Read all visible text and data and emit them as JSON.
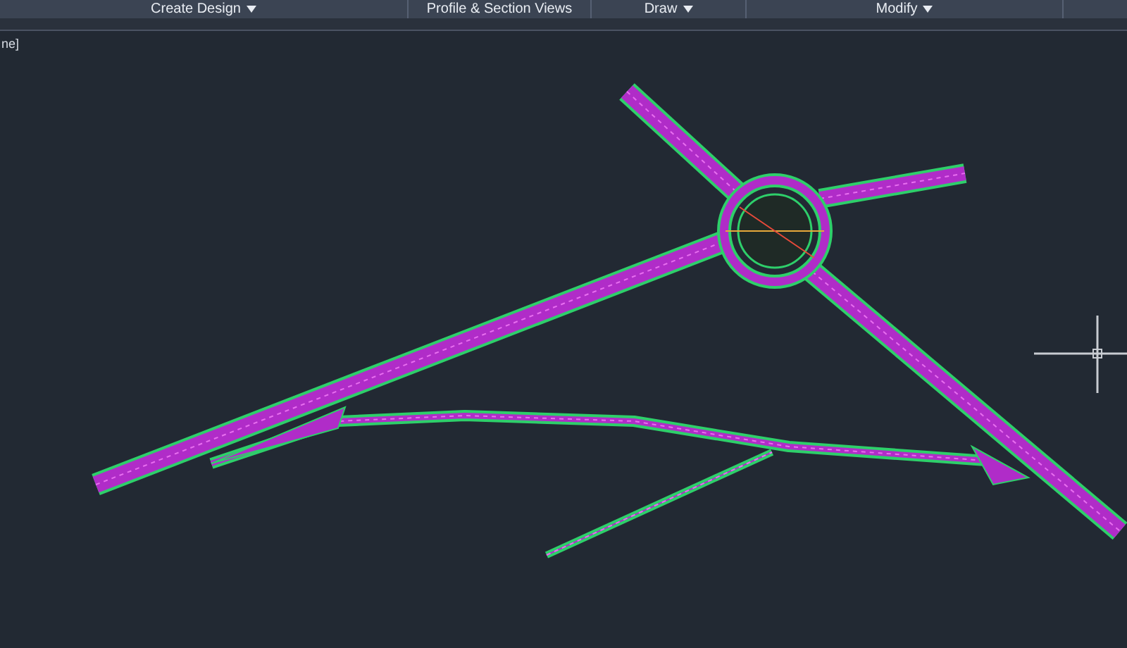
{
  "ribbon_panels": [
    {
      "label": "Create Design",
      "dropdown": true
    },
    {
      "label": "Profile & Section Views",
      "dropdown": false
    },
    {
      "label": "Draw",
      "dropdown": true
    },
    {
      "label": "Modify",
      "dropdown": true
    }
  ],
  "viewport_label": "ne]"
}
